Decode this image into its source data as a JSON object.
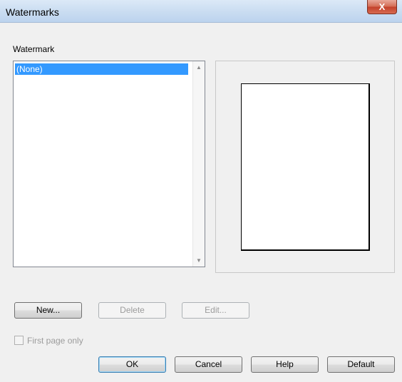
{
  "window": {
    "title": "Watermarks",
    "close_label": "X"
  },
  "watermark_group": {
    "label": "Watermark",
    "items": [
      {
        "label": "(None)",
        "selected": true
      }
    ]
  },
  "actions": {
    "new_label": "New...",
    "delete_label": "Delete",
    "edit_label": "Edit..."
  },
  "options": {
    "first_page_only_label": "First page only",
    "first_page_only_checked": false
  },
  "footer": {
    "ok_label": "OK",
    "cancel_label": "Cancel",
    "help_label": "Help",
    "default_label": "Default"
  },
  "icons": {
    "close": "close-icon",
    "scroll_up": "scroll-up-arrow-icon",
    "scroll_down": "scroll-down-arrow-icon"
  },
  "colors": {
    "selection": "#3399ff",
    "dialog_bg": "#f0f0f0",
    "close_button": "#c2402a"
  }
}
